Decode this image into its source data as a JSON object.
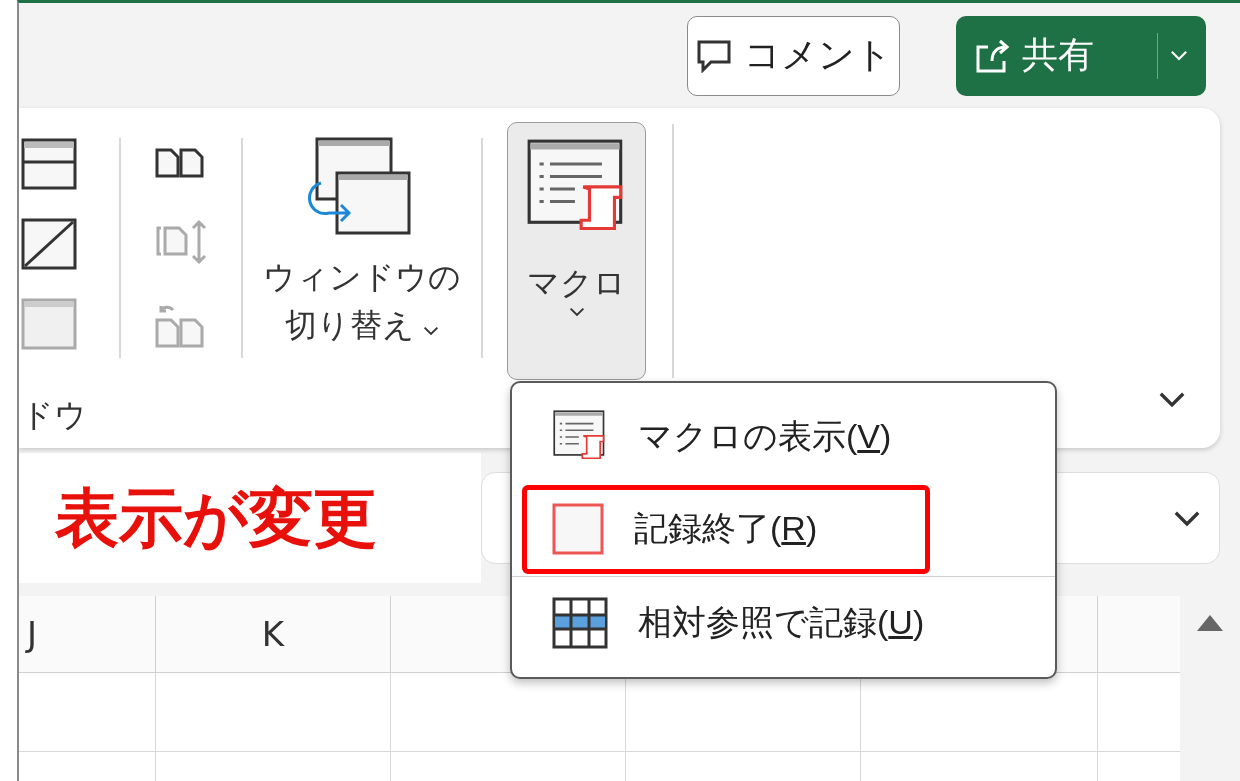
{
  "header": {
    "comment_button": "コメント",
    "share_button": "共有"
  },
  "ribbon": {
    "partial_group_label": "ドウ",
    "window_buttons": [
      {
        "kind": "split",
        "disabled": false
      },
      {
        "kind": "hide",
        "disabled": false
      },
      {
        "kind": "unhide",
        "disabled": true
      }
    ],
    "compare_buttons": [
      {
        "kind": "side-by-side",
        "disabled": false
      },
      {
        "kind": "sync-scroll",
        "disabled": true
      },
      {
        "kind": "reset-position",
        "disabled": true
      }
    ],
    "switch_windows": {
      "label_lines": [
        "ウィンドウの",
        "切り替え"
      ]
    },
    "macro_button": {
      "label": "マクロ",
      "expanded": true
    }
  },
  "annotation": "表示が変更",
  "macro_menu": {
    "items": [
      {
        "kind": "view",
        "before": "マクロの表示(",
        "access_key": "V",
        "after": ")",
        "highlighted": false
      },
      {
        "kind": "stop",
        "before": "記録終了(",
        "access_key": "R",
        "after": ")",
        "highlighted": true
      },
      {
        "kind": "relative",
        "before": "相対参照で記録(",
        "access_key": "U",
        "after": ")",
        "highlighted": false
      }
    ]
  },
  "columns": [
    "J",
    "K"
  ]
}
